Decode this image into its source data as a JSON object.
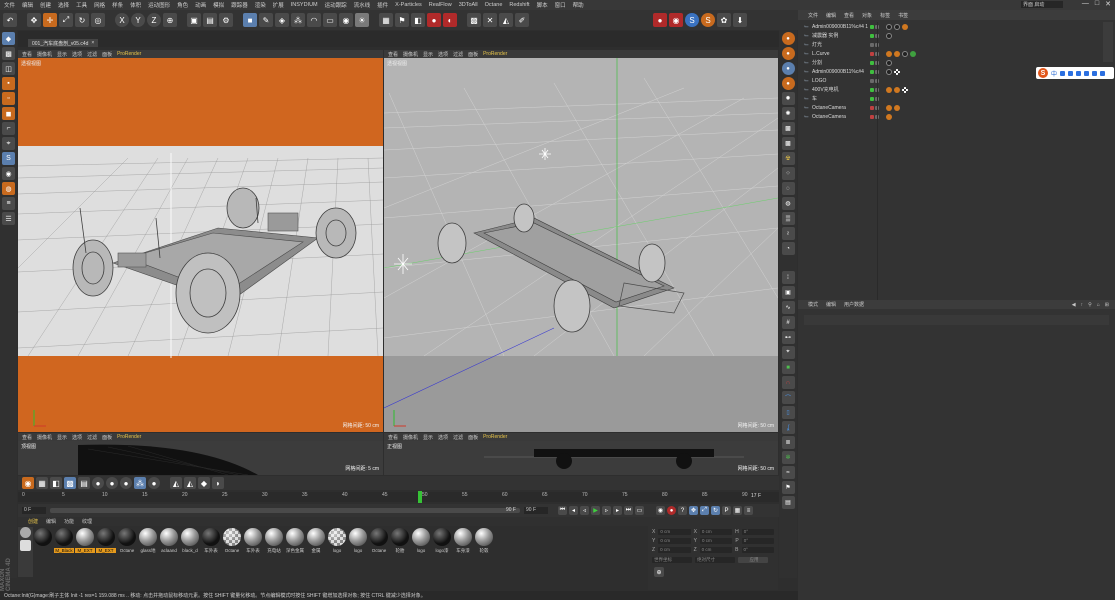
{
  "menu": [
    "文件",
    "编辑",
    "创建",
    "选择",
    "工具",
    "网格",
    "样条",
    "体积",
    "运动图形",
    "角色",
    "动画",
    "模拟",
    "跟踪器",
    "渲染",
    "扩展",
    "INSYDIUM",
    "运动跟踪",
    "流水线",
    "插件",
    "X-Particles",
    "RealFlow",
    "3DToAll",
    "Octane",
    "Redshift",
    "脚本",
    "窗口",
    "帮助"
  ],
  "window_controls": [
    "—",
    "□",
    "✕"
  ],
  "layout_label": "界面 启动",
  "document_tab": "001_汽车底盘剖_v05.c4d",
  "viewports": {
    "top_left": {
      "menu": [
        "查看",
        "摄像机",
        "显示",
        "选项",
        "过滤",
        "面板"
      ],
      "prorender": "ProRender",
      "label": "透视视图",
      "footer": "网格间距: 50 cm"
    },
    "top_right": {
      "menu": [
        "查看",
        "摄像机",
        "显示",
        "选项",
        "过滤",
        "面板"
      ],
      "prorender": "ProRender",
      "label": "透视视图",
      "footer": "网格间距: 50 cm"
    },
    "bottom_left": {
      "menu": [
        "查看",
        "摄像机",
        "显示",
        "选项",
        "过滤",
        "面板"
      ],
      "prorender": "ProRender",
      "label": "顶视图",
      "footer": "网格间距: 5 cm"
    },
    "bottom_right": {
      "menu": [
        "查看",
        "摄像机",
        "显示",
        "选项",
        "过滤",
        "面板"
      ],
      "prorender": "ProRender",
      "label": "正视图",
      "footer": "网格间距: 50 cm"
    }
  },
  "timeline": {
    "ticks": [
      "0",
      "5",
      "10",
      "15",
      "20",
      "25",
      "30",
      "35",
      "40",
      "45",
      "50",
      "55",
      "60",
      "65",
      "70",
      "75",
      "80",
      "85",
      "90"
    ],
    "current_frame": "17 F",
    "start": "0 F",
    "end_field": "90 F",
    "end_frame": "90 F",
    "range_end": "0 F"
  },
  "material_tabs": [
    "创建",
    "编辑",
    "功能",
    "纹理"
  ],
  "materials": [
    {
      "name": "",
      "type": "dk",
      "selected": false
    },
    {
      "name": "M_Black",
      "type": "dk",
      "selected": true
    },
    {
      "name": "M_EXT",
      "type": "ball",
      "selected": true
    },
    {
      "name": "M_EXT",
      "type": "dk",
      "selected": true
    },
    {
      "name": "Octane",
      "type": "dk",
      "selected": false
    },
    {
      "name": "glass地",
      "type": "ball",
      "selected": false
    },
    {
      "name": "aclaand",
      "type": "ball",
      "selected": false
    },
    {
      "name": "black_d",
      "type": "ball",
      "selected": false
    },
    {
      "name": "车外表",
      "type": "dk",
      "selected": false
    },
    {
      "name": "Octane",
      "type": "ck",
      "selected": false
    },
    {
      "name": "车外表",
      "type": "ball",
      "selected": false
    },
    {
      "name": "充电站",
      "type": "ball",
      "selected": false
    },
    {
      "name": "深色金属",
      "type": "ball",
      "selected": false
    },
    {
      "name": "金属",
      "type": "ball",
      "selected": false
    },
    {
      "name": "logo",
      "type": "ck",
      "selected": false
    },
    {
      "name": "logo",
      "type": "ball",
      "selected": false
    },
    {
      "name": "Octane",
      "type": "dk",
      "selected": false
    },
    {
      "name": "轮胎",
      "type": "dk",
      "selected": false
    },
    {
      "name": "logo",
      "type": "ball",
      "selected": false
    },
    {
      "name": "logo漆",
      "type": "dk",
      "selected": false
    },
    {
      "name": "车身漆",
      "type": "ball",
      "selected": false
    },
    {
      "name": "轮毂",
      "type": "ball",
      "selected": false
    }
  ],
  "coordinates": {
    "rows": [
      {
        "a": "X",
        "v1": "0 cm",
        "b": "X",
        "v2": "0 cm",
        "c": "H",
        "v3": "0°"
      },
      {
        "a": "Y",
        "v1": "0 cm",
        "b": "Y",
        "v2": "0 cm",
        "c": "P",
        "v3": "0°"
      },
      {
        "a": "Z",
        "v1": "0 cm",
        "b": "Z",
        "v2": "0 cm",
        "c": "B",
        "v3": "0°"
      }
    ],
    "mode": "世界坐标",
    "scale": "绝对尺寸",
    "apply": "应用"
  },
  "object_manager": {
    "tabs": [
      "文件",
      "编辑",
      "查看",
      "对象",
      "标签",
      "书签"
    ],
    "objects": [
      {
        "name": "Admin009000B11%c#4 1",
        "dot": "g"
      },
      {
        "name": "减震器 实例",
        "dot": "g"
      },
      {
        "name": "灯光",
        "dot": "n"
      },
      {
        "name": "L.Curve",
        "dot": "r"
      },
      {
        "name": "分割",
        "dot": "g"
      },
      {
        "name": "Admin009000B11%c#4",
        "dot": "g"
      },
      {
        "name": "LOGO",
        "dot": "n"
      },
      {
        "name": "400V充电机",
        "dot": "g"
      },
      {
        "name": "车",
        "dot": "g"
      },
      {
        "name": "OctaneCamera",
        "dot": "r"
      },
      {
        "name": "OctaneCamera",
        "dot": "r"
      }
    ]
  },
  "attribute_manager": {
    "tabs": [
      "模式",
      "编辑",
      "用户数据"
    ]
  },
  "status": "Octane:Init(G)mage:刷子主体 Init -1 res=1 159.088 ms ..  移动: 点击并拖动鼠标移动元素。按住 SHIFT 键量化移动。节点编辑模式时按住 SHIFT 键增加选择对象; 按住 CTRL 键减少选择对象。",
  "ime": {
    "logo": "S",
    "lang": "中"
  },
  "brand": "MAXON CINEMA 4D"
}
